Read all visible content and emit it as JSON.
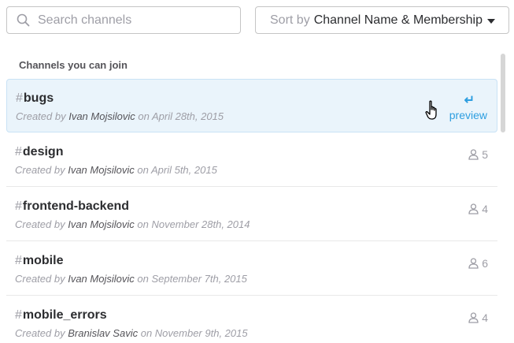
{
  "search": {
    "placeholder": "Search channels",
    "value": ""
  },
  "sort": {
    "prefix": "Sort by",
    "value": "Channel Name & Membership"
  },
  "section_title": "Channels you can join",
  "channels": [
    {
      "hash": "#",
      "name": "bugs",
      "created_prefix": "Created by",
      "creator": "Ivan Mojsilovic",
      "date_text": "on April 28th, 2015",
      "members": "",
      "hovered": true,
      "preview_label": "preview",
      "preview_icon": "↵"
    },
    {
      "hash": "#",
      "name": "design",
      "created_prefix": "Created by",
      "creator": "Ivan Mojsilovic",
      "date_text": "on April 5th, 2015",
      "members": "5"
    },
    {
      "hash": "#",
      "name": "frontend-backend",
      "created_prefix": "Created by",
      "creator": "Ivan Mojsilovic",
      "date_text": "on November 28th, 2014",
      "members": "4"
    },
    {
      "hash": "#",
      "name": "mobile",
      "created_prefix": "Created by",
      "creator": "Ivan Mojsilovic",
      "date_text": "on September 7th, 2015",
      "members": "6"
    },
    {
      "hash": "#",
      "name": "mobile_errors",
      "created_prefix": "Created by",
      "creator": "Branislav Savic",
      "date_text": "on November 9th, 2015",
      "members": "4"
    }
  ],
  "colors": {
    "accent": "#2d9ee0",
    "hover_bg": "#eaf4fb",
    "muted": "#9e9ea6"
  }
}
